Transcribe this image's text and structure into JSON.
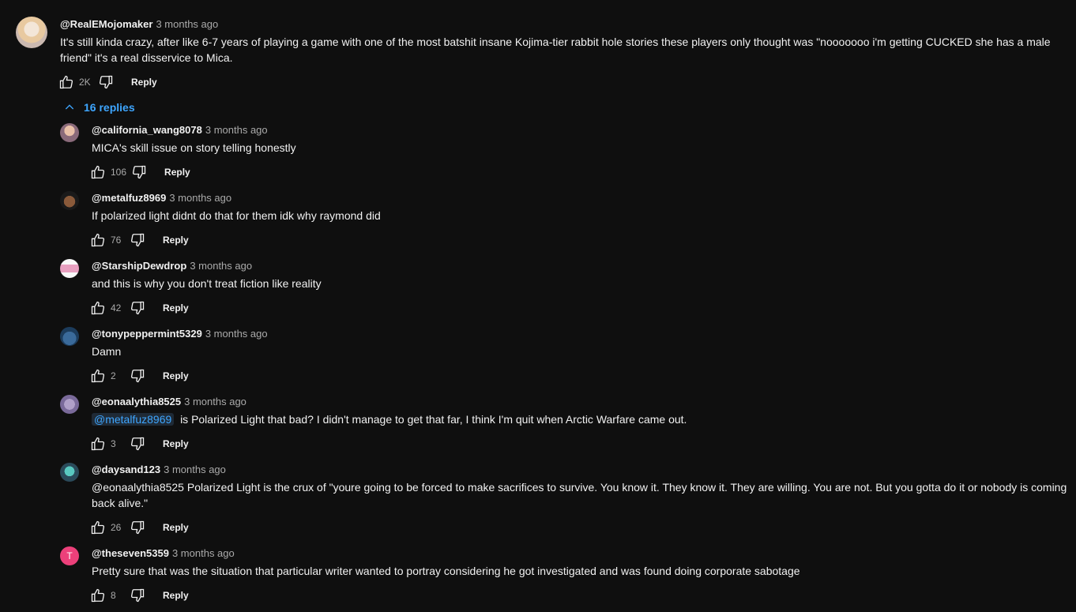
{
  "main_comment": {
    "author": "@RealEMojomaker",
    "time": "3 months ago",
    "text": "It's still kinda crazy, after like 6-7 years of playing a game with one of the most batshit insane Kojima-tier rabbit hole stories these players only thought was \"nooooooo i'm getting CUCKED she has a male friend\" it's a real disservice to Mica.",
    "likes": "2K",
    "reply_label": "Reply"
  },
  "replies_toggle": {
    "label": "16 replies",
    "icon": "chevron-up-icon"
  },
  "replies": [
    {
      "author": "@california_wang8078",
      "time": "3 months ago",
      "text": "MICA's skill issue on story telling honestly",
      "likes": "106",
      "reply_label": "Reply"
    },
    {
      "author": "@metalfuz8969",
      "time": "3 months ago",
      "text": "If polarized light didnt do that for them idk why raymond did",
      "likes": "76",
      "reply_label": "Reply"
    },
    {
      "author": "@StarshipDewdrop",
      "time": "3 months ago",
      "text": "and this is why you don't treat fiction like reality",
      "likes": "42",
      "reply_label": "Reply"
    },
    {
      "author": "@tonypeppermint5329",
      "time": "3 months ago",
      "text": "Damn",
      "likes": "2",
      "reply_label": "Reply"
    },
    {
      "author": "@eonaalythia8525",
      "time": "3 months ago",
      "mention": "@metalfuz8969",
      "text": "is Polarized Light that bad? I didn't manage to get that far, I think I'm quit when Arctic Warfare came out.",
      "likes": "3",
      "reply_label": "Reply"
    },
    {
      "author": "@daysand123",
      "time": "3 months ago",
      "text": "@eonaalythia8525 Polarized Light is the crux of \"youre going to be forced to make sacrifices to survive. You know it. They know it. They are willing. You are not. But you gotta do it or nobody is coming back alive.\"",
      "likes": "26",
      "reply_label": "Reply"
    },
    {
      "author": "@theseven5359",
      "time": "3 months ago",
      "avatar_letter": "T",
      "text": "Pretty sure that was the situation that particular writer wanted to portray considering he got investigated and was found doing corporate sabotage",
      "likes": "8",
      "reply_label": "Reply"
    }
  ],
  "colors": {
    "background": "#0f0f0f",
    "link": "#3ea6ff",
    "secondary_text": "#aaaaaa",
    "avatar_t": "#ec407a"
  }
}
